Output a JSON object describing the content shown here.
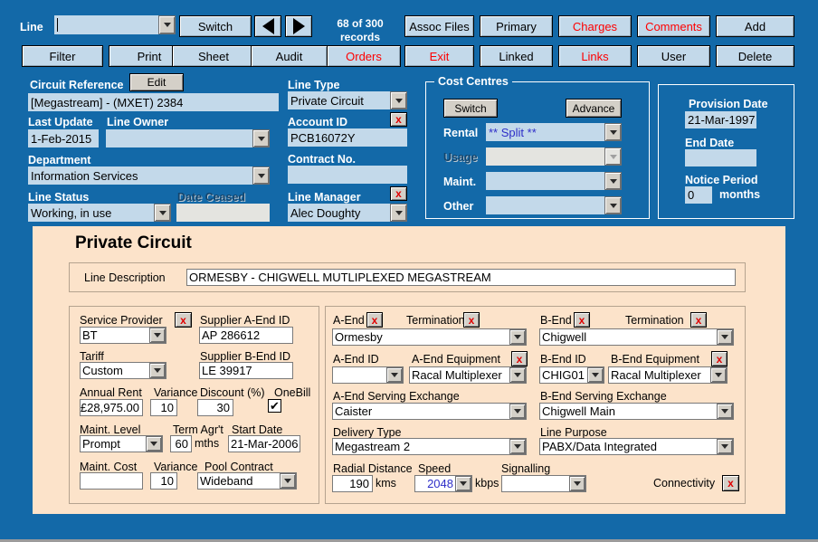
{
  "toolbar": {
    "line_label": "Line",
    "line_value": "",
    "record_count_line1": "68  of  300",
    "record_count_line2": "records",
    "row1": [
      {
        "name": "switch-button",
        "label": "Switch",
        "red": false
      },
      {
        "name": "assoc-files-button",
        "label": "Assoc Files",
        "red": false
      },
      {
        "name": "primary-button",
        "label": "Primary",
        "red": false
      },
      {
        "name": "charges-button",
        "label": "Charges",
        "red": true
      },
      {
        "name": "comments-button",
        "label": "Comments",
        "red": true
      },
      {
        "name": "add-button",
        "label": "Add",
        "red": false
      }
    ],
    "row2": [
      {
        "name": "filter-button",
        "label": "Filter",
        "red": false
      },
      {
        "name": "print-button",
        "label": "Print",
        "red": false
      },
      {
        "name": "sheet-button",
        "label": "Sheet",
        "red": false
      },
      {
        "name": "audit-button",
        "label": "Audit",
        "red": false
      },
      {
        "name": "orders-button",
        "label": "Orders",
        "red": true
      },
      {
        "name": "exit-button",
        "label": "Exit",
        "red": true
      },
      {
        "name": "linked-button",
        "label": "Linked",
        "red": false
      },
      {
        "name": "links-button",
        "label": "Links",
        "red": true
      },
      {
        "name": "user-button",
        "label": "User",
        "red": false
      },
      {
        "name": "delete-button",
        "label": "Delete",
        "red": false
      }
    ]
  },
  "circuit": {
    "reference_label": "Circuit Reference",
    "edit_label": "Edit",
    "reference_value": "[Megastream] - (MXET) 2384",
    "last_update_label": "Last Update",
    "last_update_value": "1-Feb-2015",
    "line_owner_label": "Line Owner",
    "line_owner_value": "",
    "department_label": "Department",
    "department_value": "Information Services",
    "line_status_label": "Line Status",
    "line_status_value": "Working, in use",
    "date_ceased_label": "Date Ceased",
    "date_ceased_value": ""
  },
  "linetype": {
    "line_type_label": "Line Type",
    "line_type_value": "Private Circuit",
    "account_id_label": "Account ID",
    "account_id_value": "PCB16072Y",
    "contract_no_label": "Contract No.",
    "contract_no_value": "",
    "line_manager_label": "Line Manager",
    "line_manager_value": "Alec Doughty",
    "clear_label": "x"
  },
  "cost_centres": {
    "title": "Cost Centres",
    "switch_label": "Switch",
    "advance_label": "Advance",
    "rental_label": "Rental",
    "rental_value": "** Split **",
    "usage_label": "Usage",
    "usage_value": "",
    "maint_label": "Maint.",
    "maint_value": "",
    "other_label": "Other",
    "other_value": ""
  },
  "provision": {
    "provision_date_label": "Provision Date",
    "provision_date_value": "21-Mar-1997",
    "end_date_label": "End Date",
    "end_date_value": "",
    "notice_period_label": "Notice Period",
    "notice_period_value": "0",
    "months_label": "months"
  },
  "private_circuit": {
    "title": "Private Circuit",
    "line_description_label": "Line Description",
    "line_description_value": "ORMESBY - CHIGWELL MUTLIPLEXED MEGASTREAM",
    "left": {
      "service_provider_label": "Service Provider",
      "service_provider_value": "BT",
      "supplier_a_end_label": "Supplier A-End ID",
      "supplier_a_end_value": "AP 286612",
      "tariff_label": "Tariff",
      "tariff_value": "Custom",
      "supplier_b_end_label": "Supplier B-End ID",
      "supplier_b_end_value": "LE 39917",
      "annual_rent_label": "Annual Rent",
      "annual_rent_value": "£28,975.00",
      "variance1_label": "Variance",
      "variance1_value": "10",
      "discount_label": "Discount (%)",
      "discount_value": "30",
      "onebill_label": "OneBill",
      "onebill_checked": "✔",
      "maint_level_label": "Maint. Level",
      "maint_level_value": "Prompt",
      "term_agrt_label": "Term Agr't",
      "term_agrt_value": "60",
      "mths_label": "mths",
      "start_date_label": "Start Date",
      "start_date_value": "21-Mar-2006",
      "maint_cost_label": "Maint. Cost",
      "maint_cost_value": "",
      "variance2_label": "Variance",
      "variance2_value": "10",
      "pool_contract_label": "Pool Contract",
      "pool_contract_value": "Wideband",
      "clear_label": "x"
    },
    "right": {
      "a_end_label": "A-End",
      "a_end_termination_label": "Termination",
      "a_end_value": "Ormesby",
      "b_end_label": "B-End",
      "b_end_termination_label": "Termination",
      "b_end_value": "Chigwell",
      "a_end_id_label": "A-End ID",
      "a_end_id_value": "",
      "a_end_equipment_label": "A-End Equipment",
      "a_end_equipment_value": "Racal Multiplexer",
      "b_end_id_label": "B-End ID",
      "b_end_id_value": "CHIG01",
      "b_end_equipment_label": "B-End Equipment",
      "b_end_equipment_value": "Racal Multiplexer",
      "a_end_exchange_label": "A-End Serving Exchange",
      "a_end_exchange_value": "Caister",
      "b_end_exchange_label": "B-End Serving Exchange",
      "b_end_exchange_value": "Chigwell Main",
      "delivery_type_label": "Delivery Type",
      "delivery_type_value": "Megastream 2",
      "line_purpose_label": "Line Purpose",
      "line_purpose_value": "PABX/Data Integrated",
      "radial_distance_label": "Radial Distance",
      "radial_distance_value": "190",
      "kms_label": "kms",
      "speed_label": "Speed",
      "speed_value": "2048",
      "kbps_label": "kbps",
      "signalling_label": "Signalling",
      "signalling_value": "",
      "connectivity_label": "Connectivity",
      "clear_label": "x"
    }
  },
  "colors": {
    "window_blue": "#1369a8",
    "panel_peach": "#fce3ca",
    "field_blue": "#c3d9ea",
    "button_face": "#c3d9ea",
    "accent_red": "#fe0000"
  }
}
